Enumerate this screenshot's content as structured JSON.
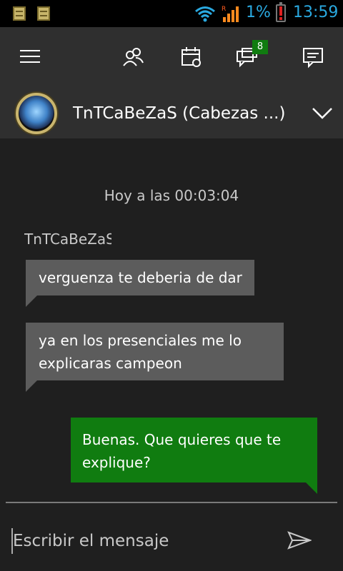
{
  "status_bar": {
    "battery_percent": "1%",
    "time": "13:59",
    "roaming_indicator": "R",
    "icons": [
      "notification-icon",
      "notification-icon",
      "wifi-icon",
      "signal-icon",
      "battery-alert-icon"
    ],
    "accent_color": "#2aa9e0"
  },
  "app_bar": {
    "icons": [
      "hamburger-menu-icon",
      "friends-icon",
      "calendar-icon",
      "messages-icon",
      "chat-compose-icon"
    ],
    "messages_badge": "8",
    "badge_color": "#107c10"
  },
  "conversation": {
    "title": "TnTCaBeZaS (Cabezas ...)",
    "timestamp": "Hoy a las 00:03:04",
    "sender": "TnTCaBeZaS",
    "messages": [
      {
        "direction": "incoming",
        "line1": "verguenza te deberia de dar",
        "line2": ""
      },
      {
        "direction": "incoming",
        "line1": "ya en los presenciales me lo",
        "line2": "explicaras campeon"
      },
      {
        "direction": "outgoing",
        "line1": "Buenas. Que quieres que te",
        "line2": "explique?"
      }
    ],
    "incoming_color": "#5c5c5c",
    "outgoing_color": "#107c10"
  },
  "composer": {
    "placeholder": "Escribir el mensaje"
  }
}
